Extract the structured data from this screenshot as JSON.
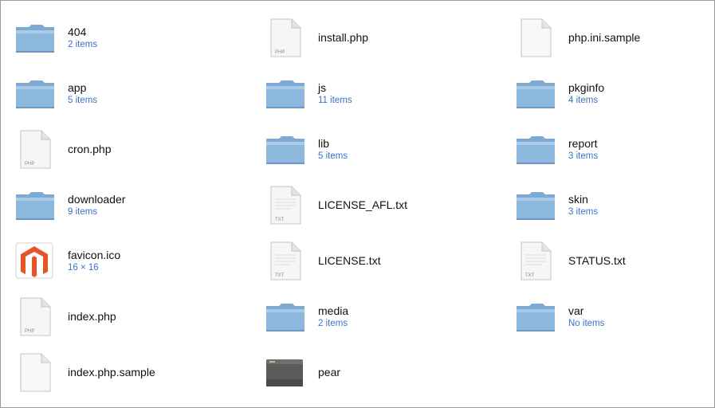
{
  "items": [
    {
      "name": "404",
      "sub": "2 items",
      "icon": "folder-icon"
    },
    {
      "name": "app",
      "sub": "5 items",
      "icon": "folder-icon"
    },
    {
      "name": "cron.php",
      "sub": "",
      "icon": "php-file-icon"
    },
    {
      "name": "downloader",
      "sub": "9 items",
      "icon": "folder-icon"
    },
    {
      "name": "favicon.ico",
      "sub": "16 × 16",
      "icon": "magento-logo-icon"
    },
    {
      "name": "index.php",
      "sub": "",
      "icon": "php-file-icon"
    },
    {
      "name": "index.php.sample",
      "sub": "",
      "icon": "blank-file-icon"
    },
    {
      "name": "install.php",
      "sub": "",
      "icon": "php-file-icon"
    },
    {
      "name": "js",
      "sub": "11 items",
      "icon": "folder-icon"
    },
    {
      "name": "lib",
      "sub": "5 items",
      "icon": "folder-icon"
    },
    {
      "name": "LICENSE_AFL.txt",
      "sub": "",
      "icon": "txt-file-icon"
    },
    {
      "name": "LICENSE.txt",
      "sub": "",
      "icon": "txt-file-icon"
    },
    {
      "name": "media",
      "sub": "2 items",
      "icon": "folder-icon"
    },
    {
      "name": "pear",
      "sub": "",
      "icon": "terminal-executable-icon"
    },
    {
      "name": "php.ini.sample",
      "sub": "",
      "icon": "blank-file-icon"
    },
    {
      "name": "pkginfo",
      "sub": "4 items",
      "icon": "folder-icon"
    },
    {
      "name": "report",
      "sub": "3 items",
      "icon": "folder-icon"
    },
    {
      "name": "skin",
      "sub": "3 items",
      "icon": "folder-icon"
    },
    {
      "name": "STATUS.txt",
      "sub": "",
      "icon": "txt-file-icon"
    },
    {
      "name": "var",
      "sub": "No items",
      "icon": "folder-icon"
    }
  ],
  "file_badges": {
    "php": "PHP",
    "txt": "TXT"
  },
  "colors": {
    "folder": "#8db8dd",
    "subtitle": "#3b72c8",
    "magento": "#e8542a"
  }
}
